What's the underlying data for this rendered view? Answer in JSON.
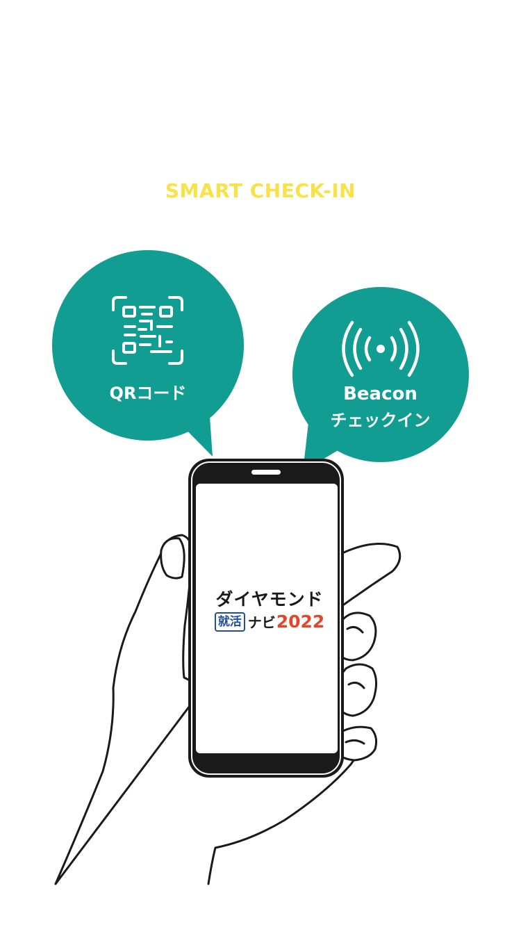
{
  "header": {
    "title": "SMART CHECK-IN"
  },
  "qr_bubble": {
    "label": "QRコード",
    "icon": "qr-code-icon"
  },
  "beacon_bubble": {
    "label_line1": "Beacon",
    "label_line2": "チェックイン",
    "icon": "beacon-signal-icon"
  },
  "phone_logo": {
    "line1": "ダイヤモンド",
    "badge": "就活",
    "navi": "ナビ",
    "year": "2022"
  },
  "colors": {
    "accent": "#119d91",
    "title": "#f7e24a",
    "logo_blue": "#1f4e9c",
    "logo_red": "#e5452b"
  }
}
